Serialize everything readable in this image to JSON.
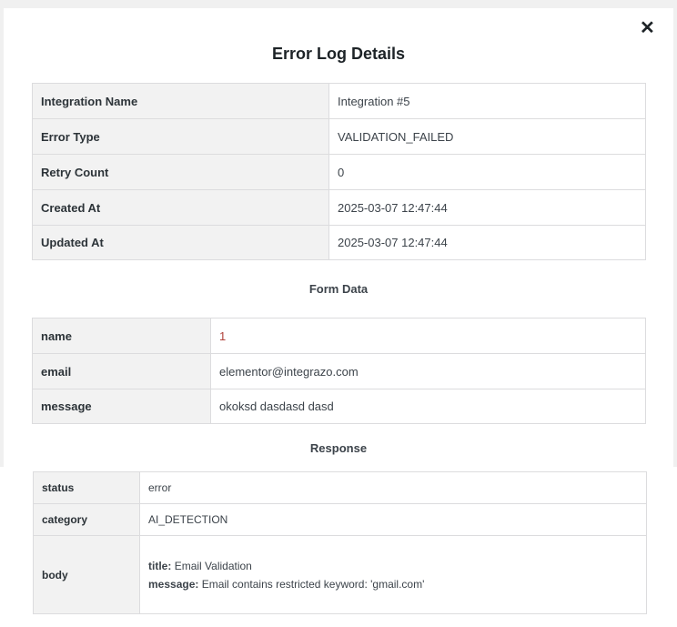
{
  "modal": {
    "title": "Error Log Details",
    "close_label": "✕"
  },
  "details": [
    {
      "label": "Integration Name",
      "value": "Integration #5"
    },
    {
      "label": "Error Type",
      "value": "VALIDATION_FAILED"
    },
    {
      "label": "Retry Count",
      "value": "0"
    },
    {
      "label": "Created At",
      "value": "2025-03-07 12:47:44"
    },
    {
      "label": "Updated At",
      "value": "2025-03-07 12:47:44"
    }
  ],
  "form_data": {
    "heading": "Form Data",
    "rows": [
      {
        "label": "name",
        "value": "1"
      },
      {
        "label": "email",
        "value": "elementor@integrazo.com"
      },
      {
        "label": "message",
        "value": "okoksd dasdasd dasd"
      }
    ]
  },
  "response": {
    "heading": "Response",
    "rows": [
      {
        "label": "status",
        "value": "error"
      },
      {
        "label": "category",
        "value": "AI_DETECTION"
      }
    ],
    "body": {
      "label": "body",
      "title_key": "title:",
      "title_value": "Email Validation",
      "message_key": "message:",
      "message_value": "Email contains restricted keyword: 'gmail.com'"
    }
  }
}
